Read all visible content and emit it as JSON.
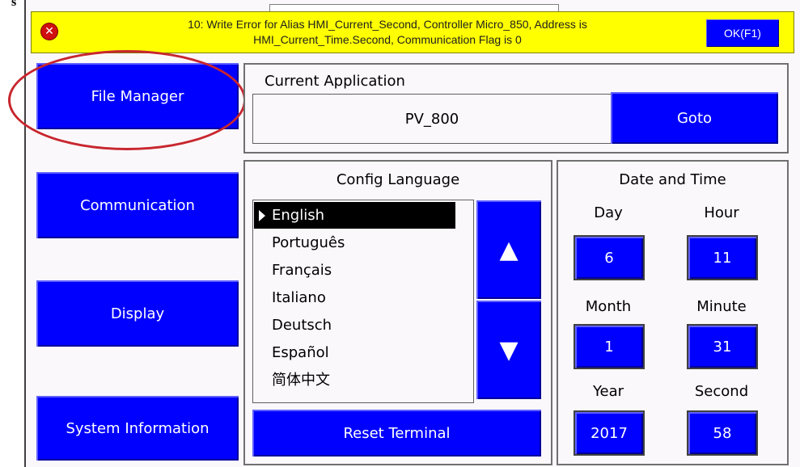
{
  "corner_mark": "s",
  "error_banner": {
    "icon": "error-x-icon",
    "line1": "10: Write Error for Alias HMI_Current_Second, Controller Micro_850, Address is",
    "line2": "HMI_Current_Time.Second, Communication Flag is 0",
    "ok_label": "OK(F1)"
  },
  "nav": {
    "file_manager": "File Manager",
    "communication": "Communication",
    "display": "Display",
    "system_information": "System Information"
  },
  "current_application": {
    "title": "Current Application",
    "value": "PV_800",
    "goto_label": "Goto"
  },
  "config_language": {
    "title": "Config Language",
    "items": [
      "English",
      "Português",
      "Français",
      "Italiano",
      "Deutsch",
      "Español",
      "简体中文"
    ],
    "selected": "English",
    "up_icon": "up-arrow-icon",
    "down_icon": "down-arrow-icon",
    "up_glyph": "▲",
    "down_glyph": "▼",
    "reset_label": "Reset Terminal"
  },
  "date_time": {
    "title": "Date and Time",
    "day_label": "Day",
    "day": "6",
    "hour_label": "Hour",
    "hour": "11",
    "month_label": "Month",
    "month": "1",
    "minute_label": "Minute",
    "minute": "31",
    "year_label": "Year",
    "year": "2017",
    "second_label": "Second",
    "second": "58"
  },
  "colors": {
    "button_blue": "#0000ff",
    "banner_yellow": "#ffff00",
    "highlight_red": "#c8262e",
    "selected_bg": "#000000"
  }
}
